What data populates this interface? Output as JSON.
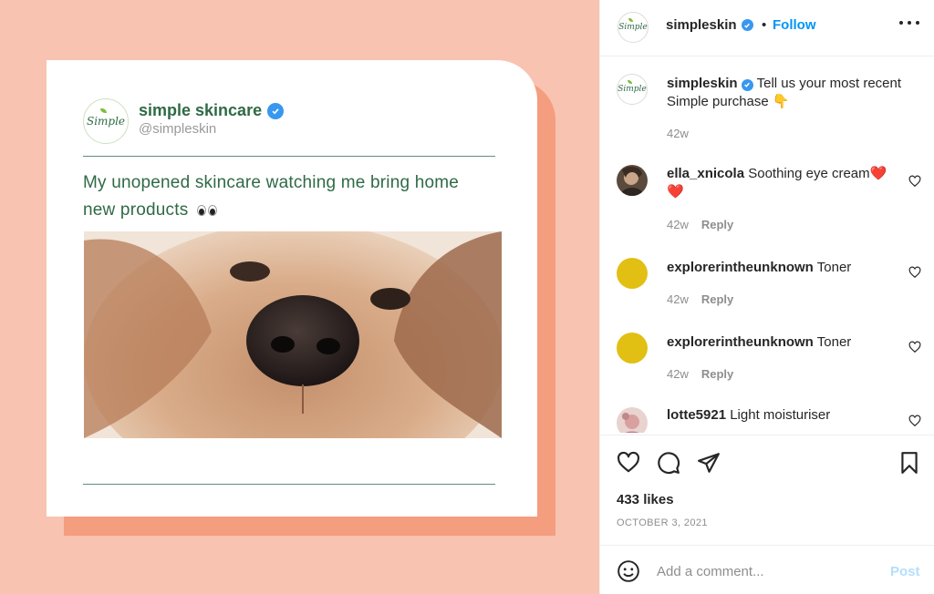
{
  "media": {
    "brand_logo_text": "Simple",
    "brand_name": "simple skincare",
    "brand_handle": "@simpleskin",
    "tweet_text": "My unopened skincare watching me bring home new products",
    "tweet_emoji": "eyes-emoji",
    "photo_subject": "puppy-nose-closeup"
  },
  "header": {
    "avatar_text": "Simple",
    "username": "simpleskin",
    "verified_icon": "verified-badge-icon",
    "separator": "•",
    "follow_label": "Follow",
    "more_icon": "more-options-icon"
  },
  "caption": {
    "avatar_text": "Simple",
    "username": "simpleskin",
    "text": "Tell us your most recent Simple purchase 👇",
    "time": "42w"
  },
  "comments": [
    {
      "username": "ella_xnicola",
      "text": "Soothing eye cream❤️❤️",
      "time": "42w",
      "reply_label": "Reply",
      "avatar_color": "#5a4a3c"
    },
    {
      "username": "explorerintheunknown",
      "text": "Toner",
      "time": "42w",
      "reply_label": "Reply",
      "avatar_color": "#e2bf13"
    },
    {
      "username": "explorerintheunknown",
      "text": "Toner",
      "time": "42w",
      "reply_label": "Reply",
      "avatar_color": "#e2bf13"
    },
    {
      "username": "lotte5921",
      "text": "Light moisturiser",
      "avatar_color": "#d9b0b0"
    }
  ],
  "actions": {
    "like_icon": "heart-icon",
    "comment_icon": "comment-icon",
    "share_icon": "send-icon",
    "save_icon": "bookmark-icon",
    "likes": "433 likes",
    "date": "OCTOBER 3, 2021"
  },
  "add_comment": {
    "emoji_icon": "smiley-icon",
    "placeholder": "Add a comment...",
    "post_label": "Post"
  },
  "colors": {
    "media_bg": "#f8c3b1",
    "card_shadow": "#f49d7f",
    "brand_green": "#2f6a45",
    "link_blue": "#0095f6",
    "post_disabled": "#b2dffc"
  }
}
